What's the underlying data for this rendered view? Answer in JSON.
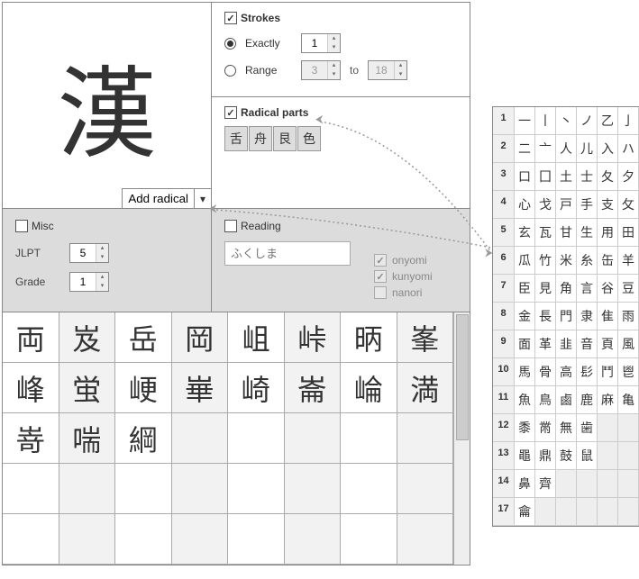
{
  "kanji_display": "漢",
  "add_radical_label": "Add radical",
  "strokes": {
    "label": "Strokes",
    "checked": true,
    "exactly_label": "Exactly",
    "exactly_value": "1",
    "range_label": "Range",
    "range_from": "3",
    "range_to_label": "to",
    "range_to": "18"
  },
  "radical_parts": {
    "label": "Radical parts",
    "checked": true,
    "parts": [
      "舌",
      "舟",
      "艮",
      "色"
    ]
  },
  "misc": {
    "label": "Misc",
    "checked": false,
    "jlpt_label": "JLPT",
    "jlpt_value": "5",
    "grade_label": "Grade",
    "grade_value": "1"
  },
  "reading": {
    "label": "Reading",
    "checked": false,
    "placeholder": "ふくしま",
    "onyomi": {
      "label": "onyomi",
      "checked": true
    },
    "kunyomi": {
      "label": "kunyomi",
      "checked": true
    },
    "nanori": {
      "label": "nanori",
      "checked": false
    }
  },
  "results": [
    [
      "両",
      "岌",
      "岳",
      "岡",
      "岨",
      "峠",
      "昞",
      "峯"
    ],
    [
      "峰",
      "蛍",
      "峺",
      "崋",
      "崎",
      "崙",
      "崘",
      "満"
    ],
    [
      "嵜",
      "喘",
      "綱",
      "",
      "",
      "",
      "",
      ""
    ],
    [
      "",
      "",
      "",
      "",
      "",
      "",
      "",
      ""
    ],
    [
      "",
      "",
      "",
      "",
      "",
      "",
      "",
      ""
    ]
  ],
  "radical_table": [
    {
      "n": "1",
      "r": [
        "一",
        "丨",
        "丶",
        "ノ",
        "乙",
        "亅"
      ]
    },
    {
      "n": "2",
      "r": [
        "二",
        "亠",
        "人",
        "儿",
        "入",
        "ハ"
      ]
    },
    {
      "n": "3",
      "r": [
        "口",
        "囗",
        "土",
        "士",
        "夂",
        "夕"
      ]
    },
    {
      "n": "4",
      "r": [
        "心",
        "戈",
        "戸",
        "手",
        "支",
        "攵"
      ]
    },
    {
      "n": "5",
      "r": [
        "玄",
        "瓦",
        "甘",
        "生",
        "用",
        "田"
      ]
    },
    {
      "n": "6",
      "r": [
        "瓜",
        "竹",
        "米",
        "糸",
        "缶",
        "羊"
      ]
    },
    {
      "n": "7",
      "r": [
        "臣",
        "見",
        "角",
        "言",
        "谷",
        "豆"
      ]
    },
    {
      "n": "8",
      "r": [
        "金",
        "長",
        "門",
        "隶",
        "隹",
        "雨"
      ]
    },
    {
      "n": "9",
      "r": [
        "面",
        "革",
        "韭",
        "音",
        "頁",
        "風"
      ]
    },
    {
      "n": "10",
      "r": [
        "馬",
        "骨",
        "高",
        "髟",
        "鬥",
        "鬯"
      ]
    },
    {
      "n": "11",
      "r": [
        "魚",
        "鳥",
        "鹵",
        "鹿",
        "麻",
        "亀"
      ]
    },
    {
      "n": "12",
      "r": [
        "黍",
        "黹",
        "無",
        "歯",
        "",
        ""
      ]
    },
    {
      "n": "13",
      "r": [
        "黽",
        "鼎",
        "鼓",
        "鼠",
        "",
        ""
      ]
    },
    {
      "n": "14",
      "r": [
        "鼻",
        "齊",
        "",
        "",
        "",
        ""
      ]
    },
    {
      "n": "17",
      "r": [
        "龠",
        "",
        "",
        "",
        "",
        ""
      ]
    }
  ]
}
